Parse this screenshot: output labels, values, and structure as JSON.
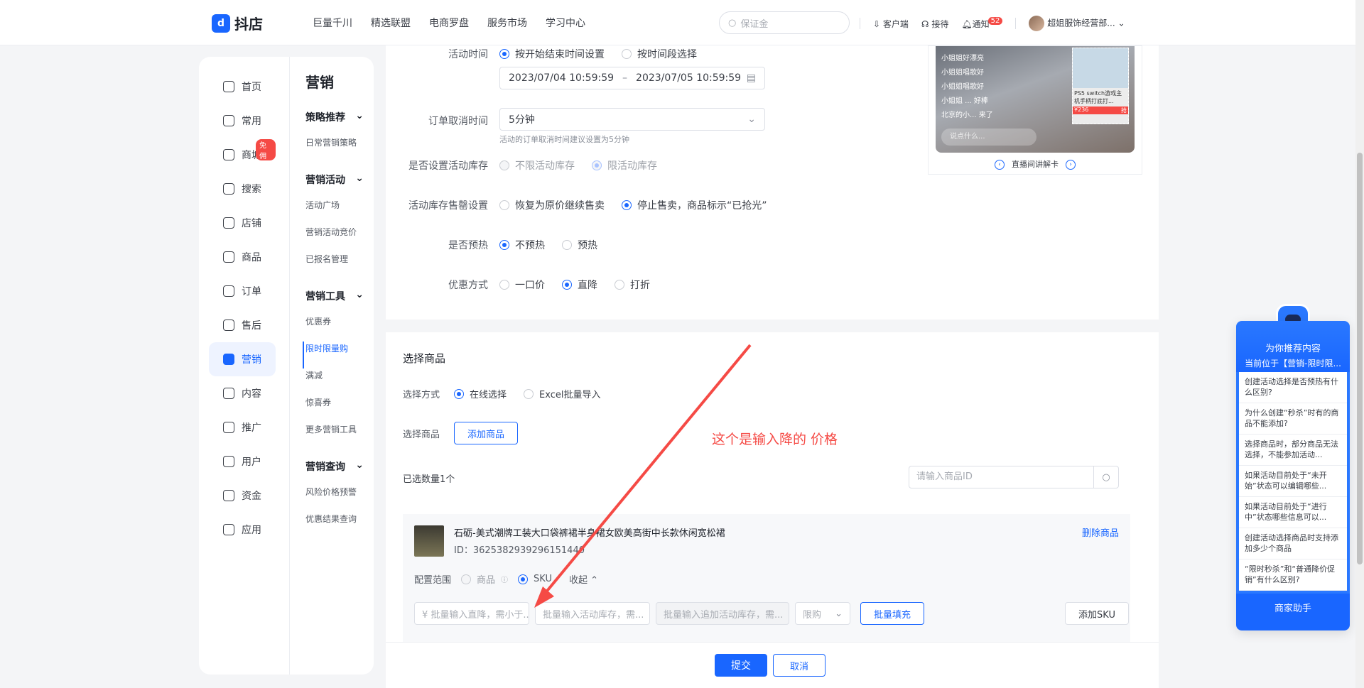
{
  "header": {
    "logo": "抖店",
    "nav": [
      "巨量千川",
      "精选联盟",
      "电商罗盘",
      "服务市场",
      "学习中心"
    ],
    "search_placeholder": "保证金",
    "tools": {
      "client": "客户端",
      "reception": "接待",
      "notice": "通知",
      "notice_count": "52",
      "shop": "超姐服饰经营部..."
    }
  },
  "sidebar": {
    "items": [
      {
        "label": "首页",
        "icon": "home-icon"
      },
      {
        "label": "常用",
        "icon": "folder-icon"
      },
      {
        "label": "商城",
        "icon": "mall-icon",
        "badge": "免佣"
      },
      {
        "label": "搜索",
        "icon": "search-icon"
      },
      {
        "label": "店铺",
        "icon": "shop-icon"
      },
      {
        "label": "商品",
        "icon": "bag-icon"
      },
      {
        "label": "订单",
        "icon": "order-icon"
      },
      {
        "label": "售后",
        "icon": "aftersale-icon"
      },
      {
        "label": "营销",
        "icon": "megaphone-icon",
        "active": true
      },
      {
        "label": "内容",
        "icon": "tv-icon"
      },
      {
        "label": "推广",
        "icon": "promote-icon"
      },
      {
        "label": "用户",
        "icon": "user-icon"
      },
      {
        "label": "资金",
        "icon": "wallet-icon"
      },
      {
        "label": "应用",
        "icon": "app-icon"
      }
    ],
    "section_title": "营销",
    "groups": [
      {
        "title": "策略推荐",
        "items": [
          "日常营销策略"
        ]
      },
      {
        "title": "营销活动",
        "items": [
          "活动广场",
          "营销活动竞价",
          "已报名管理"
        ]
      },
      {
        "title": "营销工具",
        "items": [
          "优惠券",
          "限时限量购",
          "满减",
          "惊喜券",
          "更多营销工具"
        ]
      },
      {
        "title": "营销查询",
        "items": [
          "风险价格预警",
          "优惠结果查询"
        ]
      }
    ]
  },
  "form": {
    "activity_time": {
      "label": "活动时间",
      "opt1": "按开始结束时间设置",
      "opt2": "按时间段选择",
      "start": "2023/07/04 10:59:59",
      "dash": "–",
      "end": "2023/07/05 10:59:59"
    },
    "cancel_time": {
      "label": "订单取消时间",
      "value": "5分钟",
      "hint": "活动的订单取消时间建议设置为5分钟"
    },
    "stock_limit": {
      "label": "是否设置活动库存",
      "opt1": "不限活动库存",
      "opt2": "限活动库存"
    },
    "sellout": {
      "label": "活动库存售罄设置",
      "opt1": "恢复为原价继续售卖",
      "opt2": "停止售卖，商品标示“已抢光”"
    },
    "preheat": {
      "label": "是否预热",
      "opt1": "不预热",
      "opt2": "预热"
    },
    "discount": {
      "label": "优惠方式",
      "opt1": "一口价",
      "opt2": "直降",
      "opt3": "打折"
    }
  },
  "preview": {
    "chat": [
      "小姐姐好漂亮",
      "小姐姐唱歌好",
      "小姐姐唱歌好",
      "小姐姐 ... 好棒",
      "北京的小... 来了"
    ],
    "product_name": "PS5 switch游戏主机手柄打底打...",
    "price": "¥236",
    "grab": "抢",
    "input_placeholder": "说点什么...",
    "caption": "直播间讲解卡"
  },
  "select_goods": {
    "title": "选择商品",
    "method_label": "选择方式",
    "method_opt1": "在线选择",
    "method_opt2": "Excel批量导入",
    "goods_label": "选择商品",
    "add_button": "添加商品",
    "selected_count": "已选数量1个",
    "id_search_placeholder": "请输入商品ID",
    "product": {
      "name": "石砺-美式潮牌工装大口袋裤裙半身裙女欧美高街中长款休闲宽松裙",
      "id": "ID：3625382939296151440",
      "delete": "删除商品",
      "scope_label": "配置范围",
      "scope_opt1": "商品",
      "scope_opt2": "SKU",
      "collapse": "收起"
    },
    "batch": {
      "price_placeholder": "¥  批量输入直降，需小于...",
      "stock_placeholder": "批量输入活动库存，需...",
      "extra_stock_placeholder": "批量输入追加活动库存，需...",
      "limit": "限购",
      "fill_button": "批量填充",
      "add_sku": "添加SKU"
    }
  },
  "footer": {
    "submit": "提交",
    "cancel": "取消"
  },
  "annotation": {
    "text": "这个是输入降的 价格",
    "color": "#f54a45"
  },
  "assistant": {
    "title": "为你推荐内容",
    "subtitle": "当前位于【营销-限时限...",
    "questions": [
      "创建活动选择是否预热有什么区别?",
      "为什么创建“秒杀”时有的商品不能添加?",
      "选择商品时，部分商品无法选择，不能参加活动...",
      "如果活动目前处于“未开始”状态可以编辑哪些...",
      "如果活动目前处于“进行中”状态哪些信息可以...",
      "创建活动选择商品时支持添加多少个商品",
      "“限时秒杀”和“普通降价促销”有什么区别?"
    ],
    "footer": "商家助手"
  },
  "colors": {
    "accent": "#1966ff",
    "annotation": "#f54a45"
  }
}
